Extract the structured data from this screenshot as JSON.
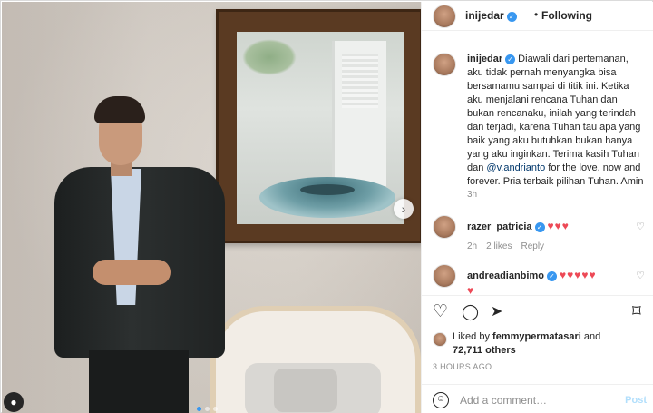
{
  "post": {
    "username": "inijedar",
    "bullet": "•",
    "follow_status": "Following",
    "verified_glyph": "✓",
    "caption_username": "inijedar",
    "caption_before": " Diawali dari pertemanan, aku tidak pernah menyangka bisa bersamamu sampai di titik ini. Ketika aku menjalani rencana Tuhan dan bukan rencanaku, inilah yang terindah dan terjadi, karena Tuhan tau apa yang baik yang aku butuhkan bukan hanya yang aku inginkan. Terima kasih Tuhan dan ",
    "caption_mention": "@v.andrianto",
    "caption_after": " for the love, now and forever. Pria terbaik pilihan Tuhan. Amin",
    "caption_time": "3h"
  },
  "photo": {
    "next_glyph": "›",
    "user_tag_glyph": "●"
  },
  "comments": [
    {
      "username": "razer_patricia",
      "text": "♥♥♥",
      "time": "2h",
      "likes": "2 likes",
      "reply": "Reply",
      "like_glyph": "♡"
    },
    {
      "username": "andreadianbimo",
      "text": "♥♥♥♥♥",
      "text2": "♥",
      "like_glyph": "♡"
    }
  ],
  "actions": {
    "like_glyph": "♡",
    "comment_glyph": "◯",
    "share_glyph": "➤",
    "save_glyph": "⌑"
  },
  "likes": {
    "prefix": "Liked by ",
    "user": "femmypermatasari",
    "middle": " and",
    "count": "72,711 others"
  },
  "timestamp": "3 HOURS AGO",
  "add_comment": {
    "emoji_glyph": "☺",
    "placeholder": "Add a comment…",
    "post_label": "Post"
  },
  "colors": {
    "verified": "#3897f0",
    "heart": "#ed4956",
    "mention": "#00376b",
    "post_disabled": "#b2dffc"
  }
}
